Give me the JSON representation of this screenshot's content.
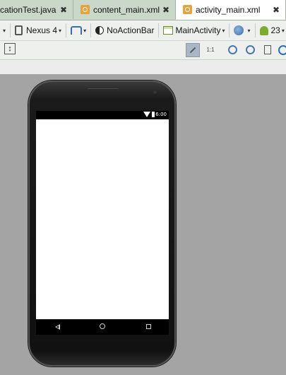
{
  "tabs": [
    {
      "label": "cationTest.java",
      "close": "✖"
    },
    {
      "label": "content_main.xml",
      "close": "✖"
    },
    {
      "label": "activity_main.xml",
      "close": "✖"
    }
  ],
  "toolbar": {
    "device": "Nexus 4",
    "theme": "NoActionBar",
    "activity": "MainActivity",
    "api": "23",
    "caret": "▾",
    "resize_glyph": "↕",
    "fit_glyph": "1:1"
  },
  "phone": {
    "time": "6:00"
  },
  "icons": {
    "nav_back": "back-icon",
    "nav_home": "home-icon",
    "nav_recent": "recent-apps-icon"
  }
}
